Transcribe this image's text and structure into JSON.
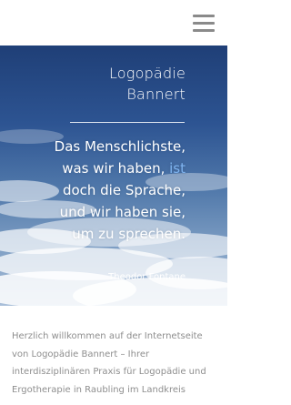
{
  "header": {
    "menu_icon": "hamburger-menu-icon"
  },
  "hero": {
    "brand_line1": "Logopädie",
    "brand_line2": "Bannert",
    "quote_line1": "Das Menschlichste,",
    "quote_line2_a": "was wir haben, ",
    "quote_line2_b": "ist",
    "quote_line3": "doch die Sprache,",
    "quote_line4": "und wir haben sie,",
    "quote_line5": "um zu sprechen.",
    "author": "Theodor Fontane",
    "accent_color": "#7fb4f0"
  },
  "intro": {
    "line1": "Herzlich willkommen auf der Internetseite",
    "line2": "von Logopädie Bannert – Ihrer",
    "line3": "interdisziplinären Praxis für Logopädie und",
    "line4": "Ergotherapie in Raubling im Landkreis"
  }
}
